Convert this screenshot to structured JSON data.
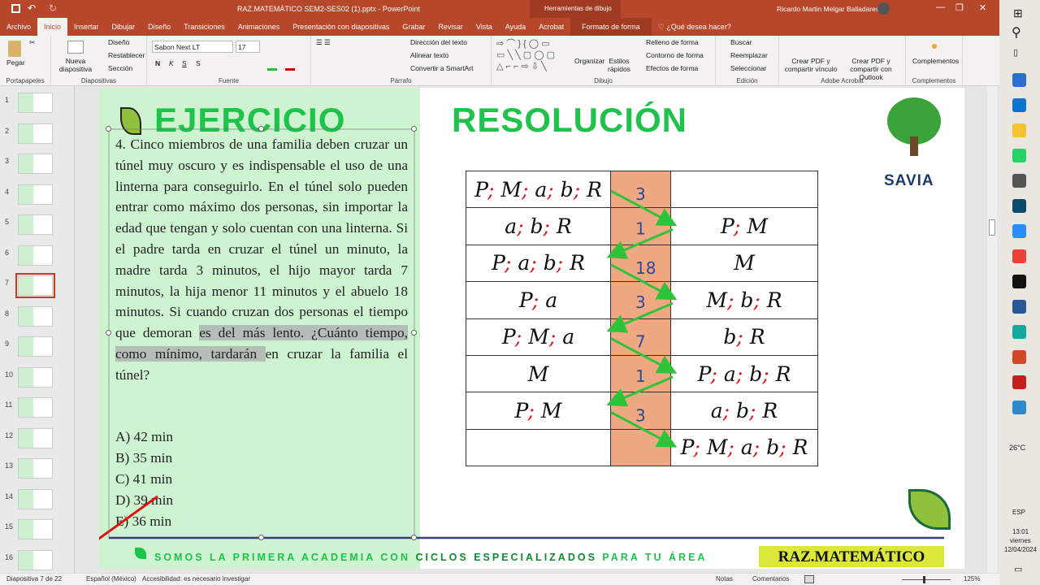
{
  "titlebar": {
    "title": "RAZ.MATEMÁTICO SEM2-SES02 (1).pptx  -  PowerPoint",
    "context": "Herramientas de dibujo",
    "user": "Ricardo Martin Melgar Balladares"
  },
  "tabs": [
    "Archivo",
    "Inicio",
    "Insertar",
    "Dibujar",
    "Diseño",
    "Transiciones",
    "Animaciones",
    "Presentación con diapositivas",
    "Grabar",
    "Revisar",
    "Vista",
    "Ayuda",
    "Acrobat",
    "Formato de forma"
  ],
  "tell_me": "¿Qué desea hacer?",
  "ribbon": {
    "paste": "Pegar",
    "new_slide": "Nueva diapositiva",
    "layout": "Diseño",
    "reset": "Restablecer",
    "section": "Sección",
    "font": "Sabon Next LT",
    "size": "17",
    "bold": "N",
    "italic": "K",
    "underline": "S",
    "strike": "S",
    "text_dir": "Dirección del texto",
    "align_text": "Alinear texto",
    "smartart": "Convertir a SmartArt",
    "arrange": "Organizar",
    "quick_styles": "Estilos rápidos",
    "fill": "Relleno de forma",
    "outline": "Contorno de forma",
    "effects": "Efectos de forma",
    "find": "Buscar",
    "replace": "Reemplazar",
    "select": "Seleccionar",
    "pdf_link": "Crear PDF y compartir vínculo",
    "pdf_outlook": "Crear PDF y compartir con Outlook",
    "addins": "Complementos",
    "groups": [
      "Portapapeles",
      "Diapositivas",
      "Fuente",
      "Párrafo",
      "Dibujo",
      "Edición",
      "Adobe Acrobat",
      "Complementos"
    ]
  },
  "thumbs": [
    "1",
    "2",
    "3",
    "4",
    "5",
    "6",
    "7",
    "8",
    "9",
    "10",
    "11",
    "12",
    "13",
    "14",
    "15",
    "16"
  ],
  "slide": {
    "left_title": "EJERCICIO",
    "right_title": "RESOLUCIÓN",
    "logo": "SAVIA",
    "problem_a": "4. Cinco miembros de una familia deben cruzar un túnel muy oscuro y es indispensable el uso de una linterna para conseguirlo. En el túnel solo pueden entrar como máximo dos personas, sin importar la edad que tengan y solo cuentan con una linterna. Si el padre tarda en cruzar el túnel un minuto, la madre tarda 3 minutos, el hijo mayor tarda 7 minutos, la hija menor 11 minutos y el abuelo 18 minutos. Si cuando cruzan dos personas el tiempo que demoran ",
    "problem_b": "es del más lento. ¿Cuánto tiempo, como mínimo, tardarán ",
    "problem_c": "en cruzar la familia el túnel?",
    "options": [
      "A) 42 min",
      "B) 35 min",
      "C) 41 min",
      "D) 39 min",
      "E) 36 min"
    ],
    "rows": [
      {
        "left": [
          "P",
          "M",
          "a",
          "b",
          "R"
        ],
        "time": "3",
        "right": []
      },
      {
        "left": [
          "a",
          "b",
          "R"
        ],
        "time": "1",
        "right": [
          "P",
          "M"
        ]
      },
      {
        "left": [
          "P",
          "a",
          "b",
          "R"
        ],
        "time": "18",
        "right": [
          "M"
        ]
      },
      {
        "left": [
          "P",
          "a"
        ],
        "time": "3",
        "right": [
          "M",
          "b",
          "R"
        ]
      },
      {
        "left": [
          "P",
          "M",
          "a"
        ],
        "time": "7",
        "right": [
          "b",
          "R"
        ]
      },
      {
        "left": [
          "M"
        ],
        "time": "1",
        "right": [
          "P",
          "a",
          "b",
          "R"
        ]
      },
      {
        "left": [
          "P",
          "M"
        ],
        "time": "3",
        "right": [
          "a",
          "b",
          "R"
        ]
      },
      {
        "left": [],
        "time": "",
        "right": [
          "P",
          "M",
          "a",
          "b",
          "R"
        ]
      }
    ],
    "footer_a": "SOMOS LA PRIMERA ACADEMIA CON ",
    "footer_b": "CICLOS ESPECIALIZADOS",
    "footer_c": " PARA TU ÁREA",
    "badge": "RAZ.MATEMÁTICO"
  },
  "status": {
    "slide": "Diapositiva 7 de 22",
    "lang": "Español (México)",
    "access": "Accesibilidad: es necesario investigar",
    "notes": "Notas",
    "comments": "Comentarios",
    "zoom": "125%"
  },
  "taskbar": {
    "temp": "26°C",
    "lang": "ESP",
    "time": "13:01",
    "day": "viernes",
    "date": "12/04/2024"
  },
  "colors": {
    "brand": "#b7472a",
    "green": "#1fc24a",
    "orange": "#f0a882"
  }
}
